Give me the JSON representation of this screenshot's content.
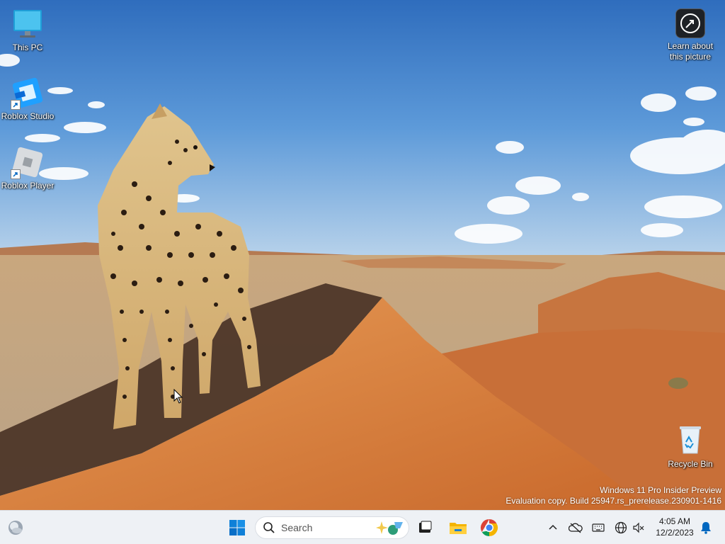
{
  "desktop": {
    "icons": [
      {
        "label": "This PC",
        "icon": "monitor-icon"
      },
      {
        "label": "Roblox Studio",
        "icon": "roblox-studio-icon"
      },
      {
        "label": "Roblox Player",
        "icon": "roblox-player-icon"
      }
    ],
    "learn_picture": {
      "line1": "Learn about",
      "line2": "this picture",
      "icon": "camera-location-icon"
    },
    "recycle_bin": {
      "label": "Recycle Bin",
      "icon": "recycle-bin-icon"
    },
    "wallpaper": "cheetah-on-desert-dune"
  },
  "watermark": {
    "line1": "Windows 11 Pro Insider Preview",
    "line2": "Evaluation copy. Build 25947.rs_prerelease.230901-1416"
  },
  "taskbar": {
    "widgets_icon": "weather-widget-icon",
    "start_icon": "windows-start-icon",
    "search_placeholder": "Search",
    "search_highlight_icon": "search-highlight-icon",
    "pinned": [
      "task-view-icon",
      "file-explorer-icon",
      "chrome-icon"
    ],
    "tray": [
      "chevron-up-icon",
      "onedrive-icon",
      "keyboard-icon",
      "globe-icon",
      "speaker-muted-icon"
    ],
    "clock": {
      "time": "4:05 AM",
      "date": "12/2/2023"
    },
    "notification_icon": "bell-icon"
  },
  "colors": {
    "accent": "#0067c0",
    "taskbar_bg": "#eef1f5"
  }
}
